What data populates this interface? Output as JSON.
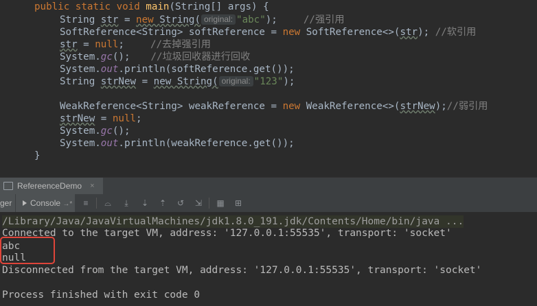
{
  "editor": {
    "lines": {
      "l1": {
        "kw1": "public static void ",
        "fn": "main",
        "rest": "(String[] args) {"
      },
      "l2": {
        "t1": "String ",
        "var": "str",
        "eq": " = ",
        "kw": "new ",
        "ctor": "String(",
        "hint": "original:",
        "str": "\"abc\"",
        "end": ");",
        "cmt": "//强引用"
      },
      "l3": {
        "t1": "SoftReference<String> softReference = ",
        "kw": "new ",
        "t2": "SoftReference<>(",
        "var": "str",
        "end": "); ",
        "cmt": "//软引用"
      },
      "l4": {
        "var": "str",
        "eq": " = ",
        "kw": "null",
        "end": ";",
        "cmt": "//去掉强引用"
      },
      "l5": {
        "t1": "System.",
        "st": "gc",
        "end": "();",
        "cmt": "//垃圾回收器进行回收"
      },
      "l6": {
        "t1": "System.",
        "st": "out",
        "end": ".println(softReference.get());"
      },
      "l7": {
        "t1": "String ",
        "var": "strNew",
        "eq": " = ",
        "ctor": "new String(",
        "hint": "original:",
        "str": "\"123\"",
        "end": ");"
      },
      "l8": {
        "t1": "WeakReference<String> weakReference = ",
        "kw": "new ",
        "t2": "WeakReference<>(",
        "var": "strNew",
        "end": ");",
        "cmt": "//弱引用"
      },
      "l9": {
        "var": "strNew",
        "eq": " = ",
        "kw": "null",
        "end": ";"
      },
      "l10": {
        "t1": "System.",
        "st": "gc",
        "end": "();"
      },
      "l11": {
        "t1": "System.",
        "st": "out",
        "end": ".println(weakReference.get());"
      },
      "l12": {
        "t1": "}"
      }
    }
  },
  "run_tab": {
    "label": "RefereenceDemo",
    "close": "×"
  },
  "toolbar": {
    "debugger_label": "ger",
    "console_label": "Console",
    "console_suffix": "→*"
  },
  "console": {
    "lines": [
      "/Library/Java/JavaVirtualMachines/jdk1.8.0_191.jdk/Contents/Home/bin/java ...",
      "Connected to the target VM, address: '127.0.0.1:55535', transport: 'socket'",
      "abc",
      "null",
      "Disconnected from the target VM, address: '127.0.0.1:55535', transport: 'socket'",
      "",
      "Process finished with exit code 0"
    ]
  },
  "colors": {
    "highlight_box": "#e0453a",
    "keyword": "#cc7832",
    "string": "#6a8759",
    "comment": "#808080",
    "static": "#9876aa",
    "method": "#ffc66d"
  }
}
